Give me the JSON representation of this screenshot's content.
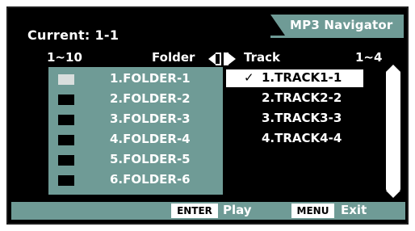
{
  "header": {
    "title": "MP3 Navigator",
    "current_label": "Current: 1-1"
  },
  "columns": {
    "folder_range": "1~10",
    "folder_label": "Folder",
    "track_label": "Track",
    "track_range": "1~4"
  },
  "folders": [
    {
      "label": "1.FOLDER-1",
      "selected": true
    },
    {
      "label": "2.FOLDER-2",
      "selected": false
    },
    {
      "label": "3.FOLDER-3",
      "selected": false
    },
    {
      "label": "4.FOLDER-4",
      "selected": false
    },
    {
      "label": "5.FOLDER-5",
      "selected": false
    },
    {
      "label": "6.FOLDER-6",
      "selected": false
    }
  ],
  "tracks": [
    {
      "label": "1.TRACK1-1",
      "selected": true,
      "check": "✓"
    },
    {
      "label": "2.TRACK2-2",
      "selected": false,
      "check": ""
    },
    {
      "label": "3.TRACK3-3",
      "selected": false,
      "check": ""
    },
    {
      "label": "4.TRACK4-4",
      "selected": false,
      "check": ""
    }
  ],
  "footer": {
    "enter_key": "ENTER",
    "enter_action": "Play",
    "menu_key": "MENU",
    "menu_action": "Exit"
  },
  "colors": {
    "accent": "#6f9b96",
    "background": "#000000",
    "text": "#ffffff"
  },
  "icons": {
    "folder_track_toggle": "left-right-arrows-icon",
    "selected_check": "checkmark-icon",
    "scroll": "scroll-arrows-icon"
  }
}
